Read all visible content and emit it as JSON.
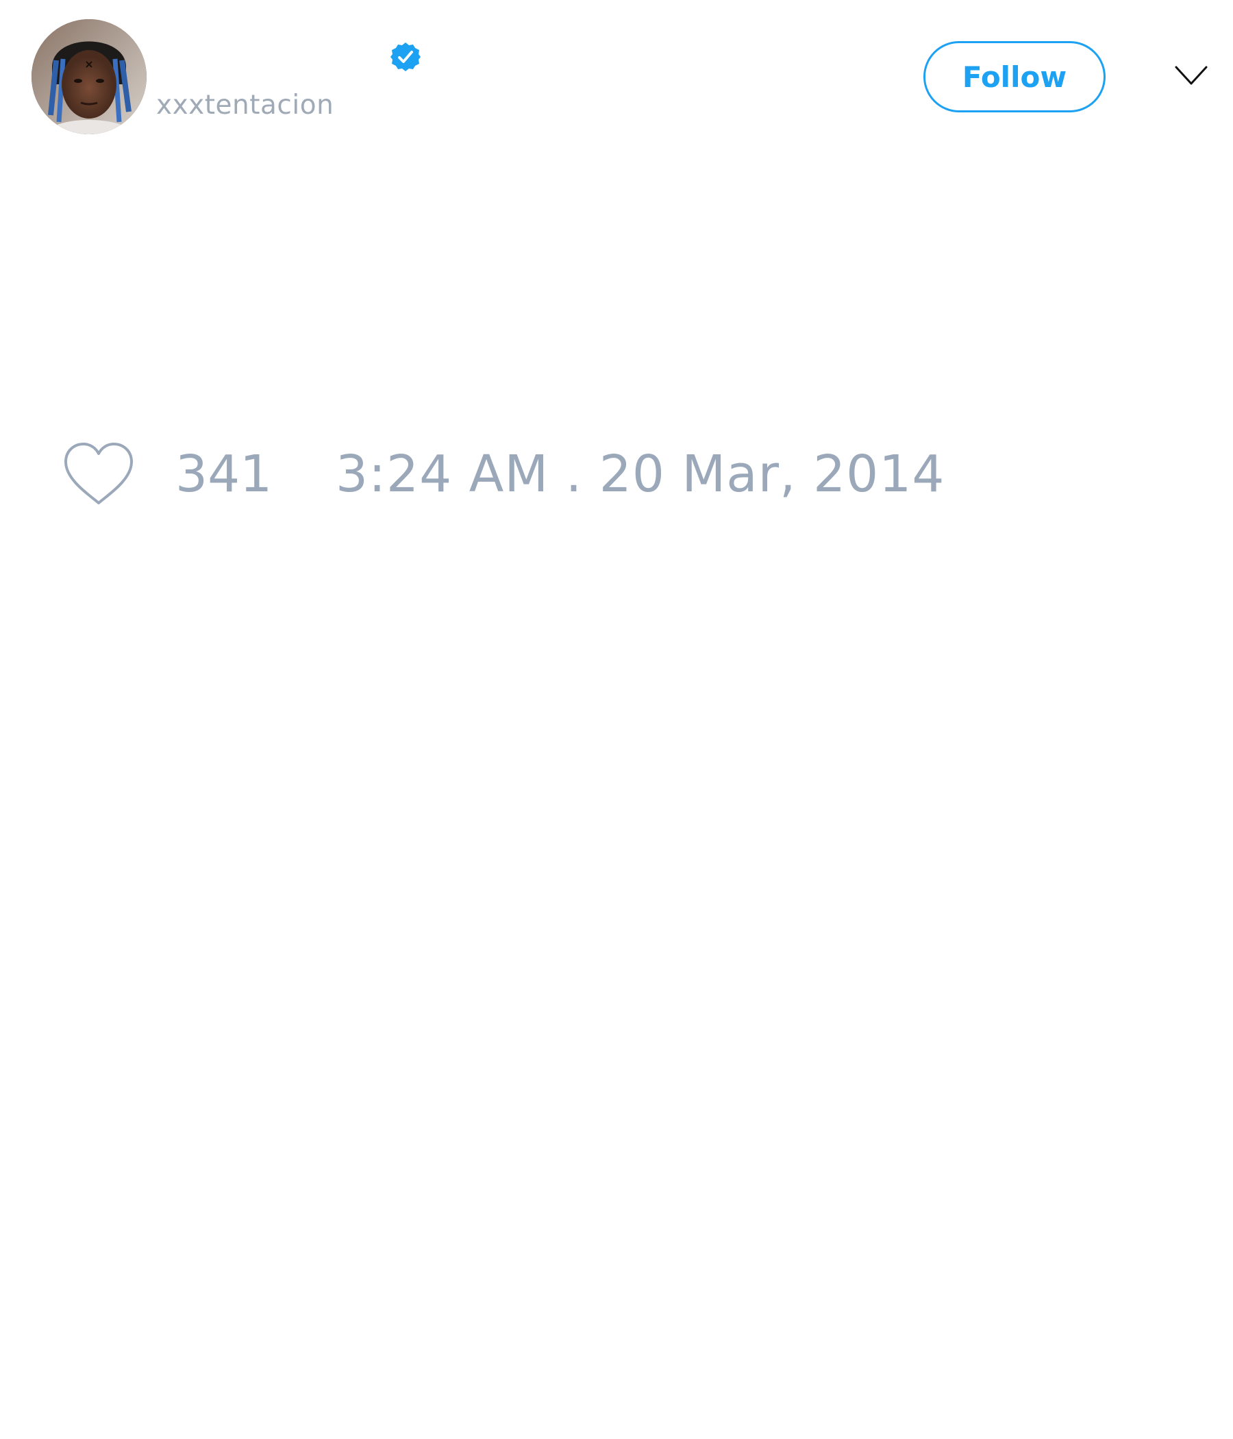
{
  "tweet": {
    "author": {
      "handle": "xxxtentacion",
      "avatar_icon": "profile-photo",
      "verified": true,
      "verified_icon": "verified-badge-icon"
    },
    "header": {
      "follow_label": "Follow",
      "menu_icon": "chevron-down-icon"
    },
    "footer": {
      "like_icon": "heart-icon",
      "like_count": "341",
      "timestamp": "3:24 AM . 20 Mar, 2014"
    }
  },
  "colors": {
    "accent": "#1da1f2",
    "muted_text": "#9aa8ba",
    "handle_text": "#a0aab6",
    "background": "#ffffff"
  }
}
